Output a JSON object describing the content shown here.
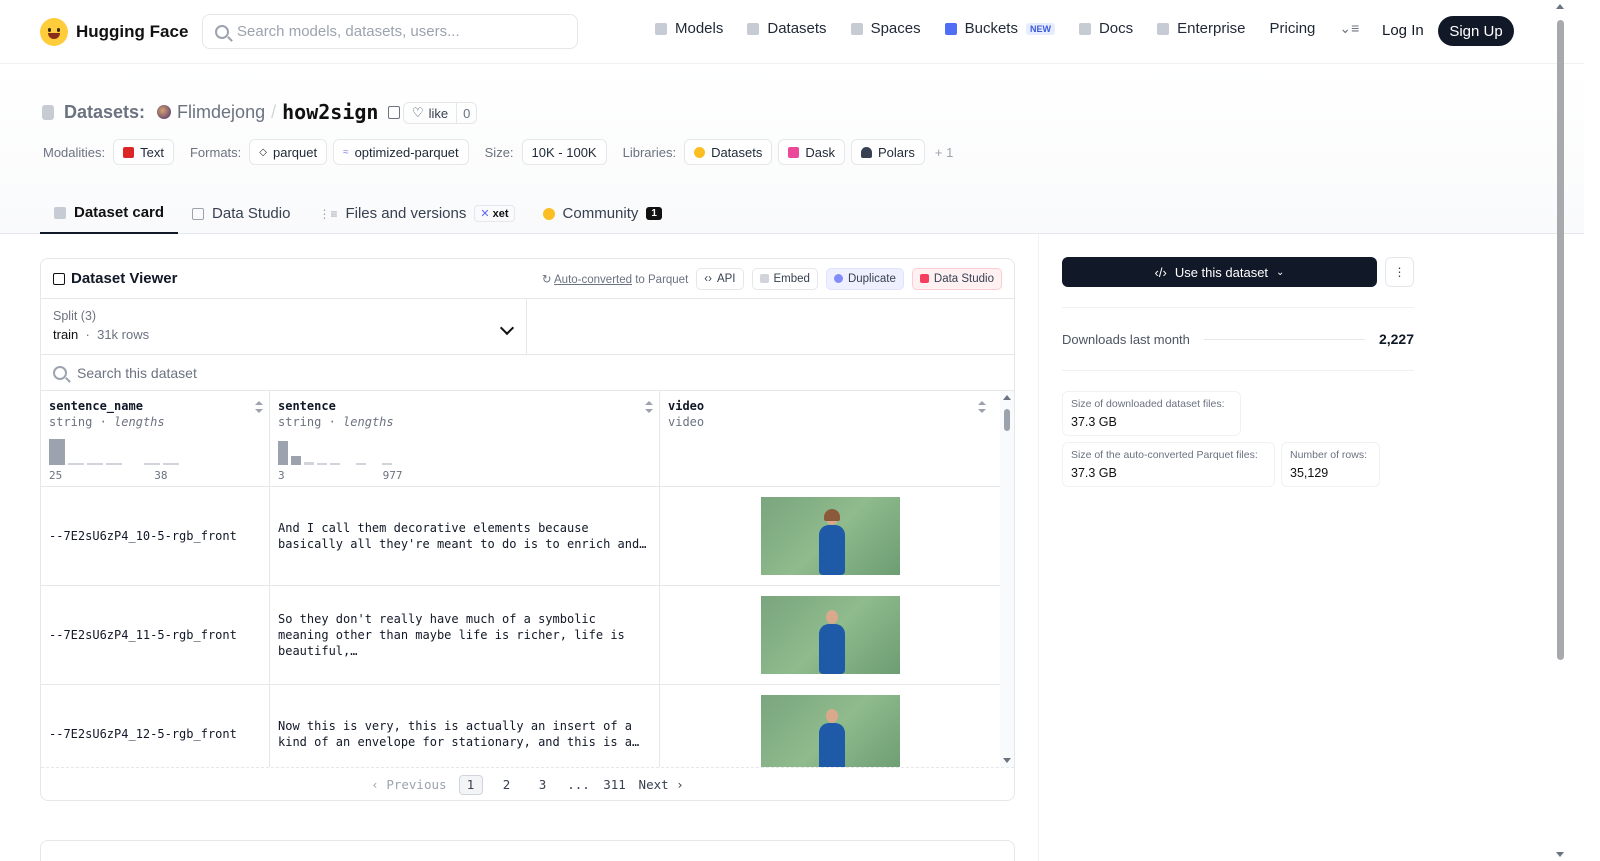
{
  "nav": {
    "brand": "Hugging Face",
    "search_placeholder": "Search models, datasets, users...",
    "links": [
      "Models",
      "Datasets",
      "Spaces",
      "Buckets",
      "Docs",
      "Enterprise",
      "Pricing"
    ],
    "buckets_badge": "NEW",
    "login": "Log In",
    "signup": "Sign Up"
  },
  "header": {
    "section": "Datasets:",
    "owner": "Flimdejong",
    "separator": "/",
    "name": "how2sign",
    "like_label": "like",
    "like_count": "0"
  },
  "tags": {
    "modalities_label": "Modalities:",
    "modalities": [
      "Text"
    ],
    "formats_label": "Formats:",
    "formats": [
      "parquet",
      "optimized-parquet"
    ],
    "size_label": "Size:",
    "size": "10K - 100K",
    "libraries_label": "Libraries:",
    "libraries": [
      "Datasets",
      "Dask",
      "Polars"
    ],
    "more": "+ 1"
  },
  "tabs": {
    "card": "Dataset card",
    "studio": "Data Studio",
    "files": "Files and versions",
    "xet": "xet",
    "community": "Community",
    "community_count": "1"
  },
  "viewer": {
    "title": "Dataset Viewer",
    "auto_converted": "Auto-converted",
    "to_parquet": " to Parquet",
    "api": "API",
    "embed": "Embed",
    "duplicate": "Duplicate",
    "data_studio": "Data Studio",
    "split_label": "Split (3)",
    "split_value": "train",
    "split_rows": "31k rows",
    "search_placeholder": "Search this dataset",
    "columns": [
      {
        "name": "sentence_name",
        "type": "string",
        "extra": "lengths",
        "min": "25",
        "max": "38"
      },
      {
        "name": "sentence",
        "type": "string",
        "extra": "lengths",
        "min": "3",
        "max": "977"
      },
      {
        "name": "video",
        "type": "video",
        "extra": "",
        "min": "",
        "max": ""
      }
    ],
    "rows": [
      {
        "sentence_name": "--7E2sU6zP4_10-5-rgb_front",
        "sentence": "And I call them decorative elements because basically all they're meant to do is to enrich and…"
      },
      {
        "sentence_name": "--7E2sU6zP4_11-5-rgb_front",
        "sentence": "So they don't really have much of a symbolic meaning other than maybe life is richer, life is beautiful,…"
      },
      {
        "sentence_name": "--7E2sU6zP4_12-5-rgb_front",
        "sentence": "Now this is very, this is actually an insert of a kind of an envelope for stationary, and this is a…"
      }
    ],
    "pager": {
      "prev": "Previous",
      "pages": [
        "1",
        "2",
        "3",
        "...",
        "311"
      ],
      "next": "Next"
    }
  },
  "sidebar": {
    "use_button": "Use this dataset",
    "downloads_label": "Downloads last month",
    "downloads_value": "2,227",
    "stats": [
      {
        "label": "Size of downloaded dataset files:",
        "value": "37.3 GB"
      },
      {
        "label": "Size of the auto-converted Parquet files:",
        "value": "37.3 GB"
      },
      {
        "label": "Number of rows:",
        "value": "35,129"
      }
    ]
  }
}
